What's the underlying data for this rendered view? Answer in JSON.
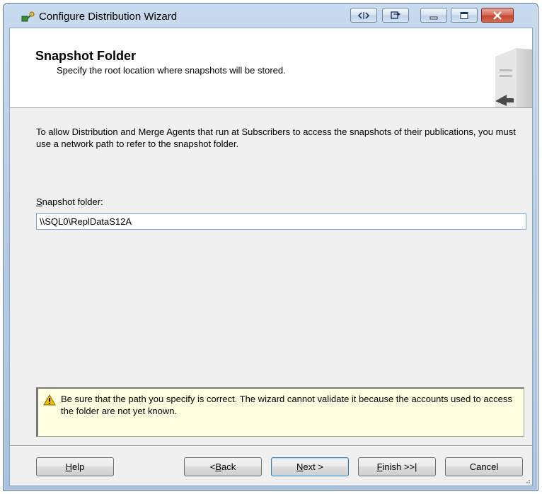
{
  "window": {
    "title": "Configure Distribution Wizard",
    "controls": {
      "extra1_icon": "code-window-icon",
      "extra2_icon": "restore-window-icon",
      "minimize_icon": "minimize-icon",
      "maximize_icon": "maximize-icon",
      "close_icon": "close-icon"
    }
  },
  "header": {
    "title": "Snapshot Folder",
    "subtitle": "Specify the root location where snapshots will be stored."
  },
  "body": {
    "intro": "To allow Distribution and Merge Agents that run at Subscribers to access the snapshots of their publications, you must use a network path to refer to the snapshot folder.",
    "folder_label_accel": "S",
    "folder_label_rest": "napshot folder:",
    "folder_value": "\\\\SQL0\\ReplDataS12A"
  },
  "warning": {
    "icon": "warning-icon",
    "text": "Be sure that the path you specify is correct. The wizard cannot validate it because the accounts used to access the folder are not yet known."
  },
  "buttons": {
    "help": {
      "accel": "H",
      "rest": "elp"
    },
    "back": {
      "pre": "< ",
      "accel": "B",
      "rest": "ack"
    },
    "next": {
      "accel": "N",
      "rest": "ext >"
    },
    "finish": {
      "accel": "F",
      "rest": "inish >>|"
    },
    "cancel": {
      "label": "Cancel"
    }
  },
  "colors": {
    "titlebar": "#b7cde6",
    "warning_bg": "#ffffe1",
    "input_border": "#7da2ce"
  }
}
